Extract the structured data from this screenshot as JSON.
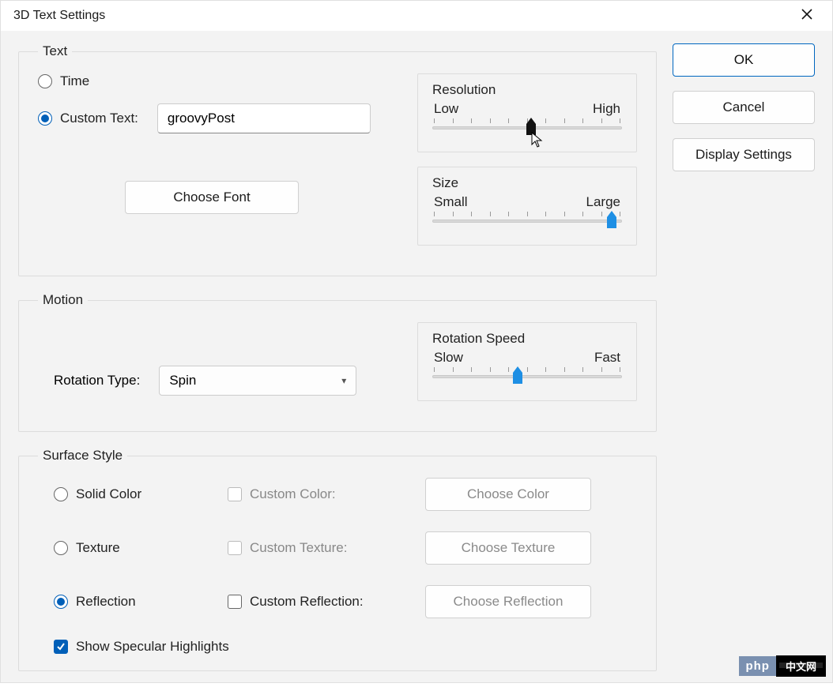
{
  "title": "3D Text Settings",
  "buttons": {
    "ok": "OK",
    "cancel": "Cancel",
    "display_settings": "Display Settings",
    "choose_font": "Choose Font",
    "choose_color": "Choose Color",
    "choose_texture": "Choose Texture",
    "choose_reflection": "Choose Reflection"
  },
  "text_group": {
    "legend": "Text",
    "time_label": "Time",
    "custom_text_label": "Custom Text:",
    "custom_text_value": "groovyPost",
    "selected": "custom"
  },
  "resolution": {
    "title": "Resolution",
    "low": "Low",
    "high": "High",
    "value_percent": 52,
    "ticks": 11
  },
  "size": {
    "title": "Size",
    "small": "Small",
    "large": "Large",
    "value_percent": 95,
    "ticks": 11
  },
  "motion_group": {
    "legend": "Motion",
    "rotation_type_label": "Rotation Type:",
    "rotation_type_value": "Spin"
  },
  "rotation_speed": {
    "title": "Rotation Speed",
    "slow": "Slow",
    "fast": "Fast",
    "value_percent": 45,
    "ticks": 11
  },
  "surface_group": {
    "legend": "Surface Style",
    "solid_color": "Solid Color",
    "texture": "Texture",
    "reflection": "Reflection",
    "custom_color": "Custom Color:",
    "custom_texture": "Custom Texture:",
    "custom_reflection": "Custom Reflection:",
    "specular": "Show Specular Highlights",
    "selected": "reflection",
    "specular_checked": true
  },
  "badge": {
    "left": "php",
    "right": "中文网"
  }
}
